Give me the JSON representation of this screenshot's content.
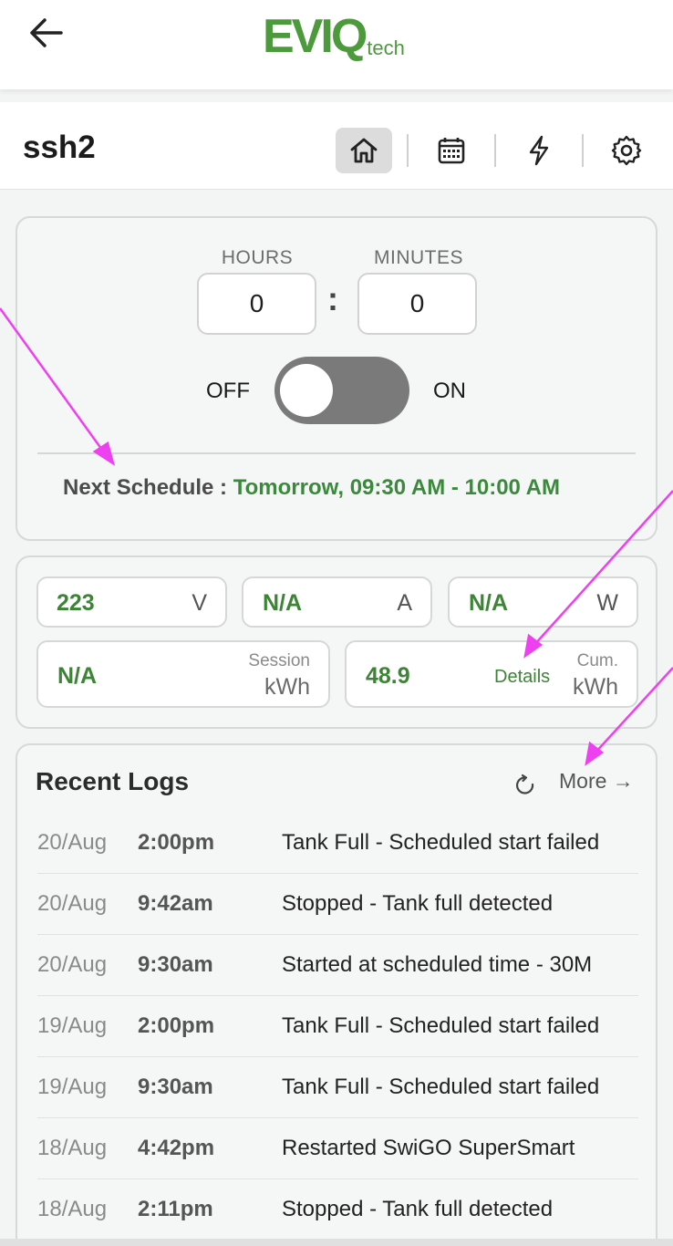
{
  "header": {
    "logo_main": "EVIQ",
    "logo_sub": "tech"
  },
  "device": {
    "name": "ssh2",
    "nav": [
      "home-icon",
      "calendar-icon",
      "lightning-icon",
      "gear-icon"
    ],
    "active_nav": "home-icon"
  },
  "timer": {
    "hours_label": "HOURS",
    "minutes_label": "MINUTES",
    "hours_value": "0",
    "minutes_value": "0",
    "colon": ":",
    "off_label": "OFF",
    "on_label": "ON",
    "toggle_state": "off",
    "schedule_label": "Next Schedule : ",
    "schedule_value": "Tomorrow, 09:30 AM - 10:00 AM"
  },
  "metrics": {
    "voltage": {
      "value": "223",
      "unit": "V"
    },
    "current": {
      "value": "N/A",
      "unit": "A"
    },
    "power": {
      "value": "N/A",
      "unit": "W"
    },
    "session": {
      "value": "N/A",
      "label": "Session",
      "unit": "kWh"
    },
    "cumulative": {
      "value": "48.9",
      "details": "Details",
      "label": "Cum.",
      "unit": "kWh"
    }
  },
  "logs": {
    "title": "Recent Logs",
    "more_label": "More →",
    "rows": [
      {
        "date": "20/Aug",
        "time": "2:00pm",
        "message": "Tank Full - Scheduled start failed"
      },
      {
        "date": "20/Aug",
        "time": "9:42am",
        "message": "Stopped - Tank full detected"
      },
      {
        "date": "20/Aug",
        "time": "9:30am",
        "message": "Started at scheduled time - 30M"
      },
      {
        "date": "19/Aug",
        "time": "2:00pm",
        "message": "Tank Full - Scheduled start failed"
      },
      {
        "date": "19/Aug",
        "time": "9:30am",
        "message": "Tank Full - Scheduled start failed"
      },
      {
        "date": "18/Aug",
        "time": "4:42pm",
        "message": "Restarted SwiGO SuperSmart"
      },
      {
        "date": "18/Aug",
        "time": "2:11pm",
        "message": "Stopped - Tank full detected"
      }
    ]
  },
  "colors": {
    "brand_green": "#4c9a3c",
    "value_green": "#3d8437",
    "annotation": "#ee3ff0"
  }
}
